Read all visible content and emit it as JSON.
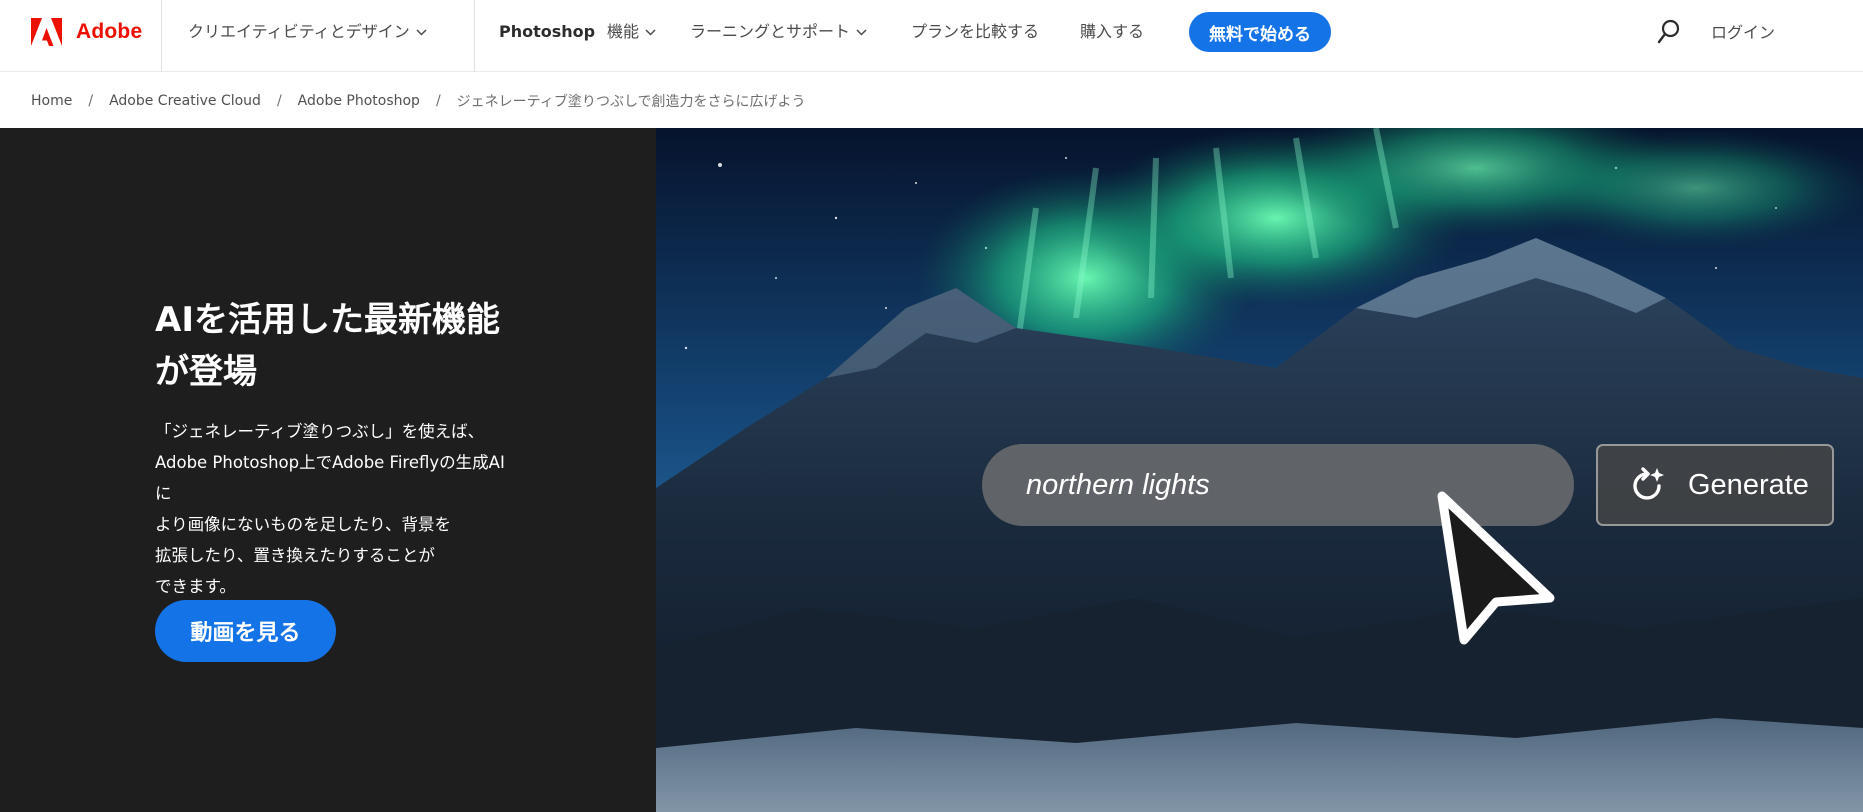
{
  "brand": {
    "name": "Adobe"
  },
  "nav": {
    "items": [
      {
        "label": "クリエイティビティとデザイン",
        "dropdown": true
      },
      {
        "label": "Photoshop",
        "dropdown": false
      },
      {
        "label": "機能",
        "dropdown": true
      },
      {
        "label": "ラーニングとサポート",
        "dropdown": true
      },
      {
        "label": "プランを比較する",
        "dropdown": false
      },
      {
        "label": "購入する",
        "dropdown": false
      }
    ],
    "cta_label": "無料で始める",
    "search_icon": "search-icon",
    "login_label": "ログイン"
  },
  "breadcrumb": {
    "items": [
      "Home",
      "Adobe Creative Cloud",
      "Adobe Photoshop"
    ],
    "current": "ジェネレーティブ塗りつぶしで創造力をさらに広げよう",
    "separator": "/"
  },
  "hero": {
    "title_line1": "AIを活用した最新機能",
    "title_line2": "が登場",
    "body_line1": "「ジェネレーティブ塗りつぶし」を使えば、",
    "body_line2": "Adobe Photoshop上でAdobe Fireflyの生成AIに",
    "body_line3": "より画像にないものを足したり、背景を",
    "body_line4": "拡張したり、置き換えたりすることが",
    "body_line5": "できます。",
    "button_label": "動画を見る",
    "prompt_value": "northern lights",
    "generate_label": "Generate"
  },
  "colors": {
    "brand_red": "#eb1000",
    "accent_blue": "#1473e6",
    "hero_dark": "#1e1e1e"
  }
}
